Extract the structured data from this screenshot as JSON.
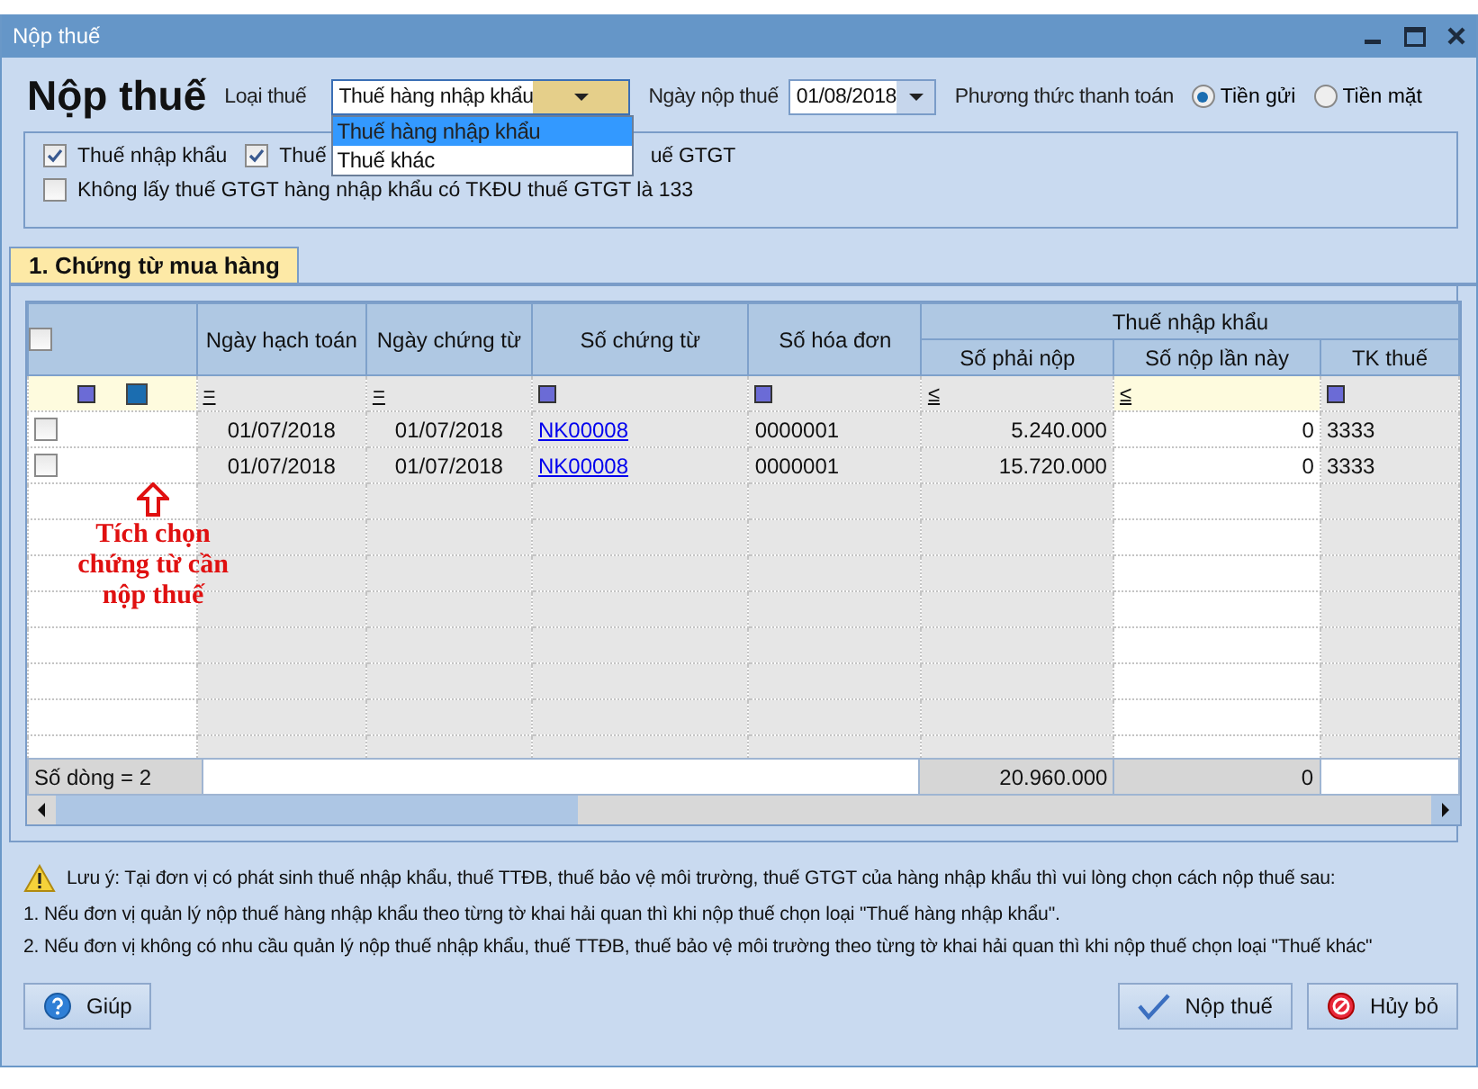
{
  "window": {
    "title": "Nộp thuế"
  },
  "header": {
    "title": "Nộp thuế",
    "tax_type": {
      "label": "Loại thuế",
      "value": "Thuế hàng nhập khẩu",
      "expanded": true,
      "options": [
        {
          "label": "Thuế hàng nhập khẩu",
          "selected": true
        },
        {
          "label": "Thuế khác",
          "selected": false
        }
      ]
    },
    "pay_date": {
      "label": "Ngày nộp thuế",
      "value": "01/08/2018"
    },
    "payment_method": {
      "label": "Phương thức thanh toán",
      "options": [
        {
          "label": "Tiền gửi",
          "selected": true
        },
        {
          "label": "Tiền mặt",
          "selected": false
        }
      ]
    }
  },
  "option_rows": [
    [
      {
        "label": "Thuế nhập khẩu",
        "checked": true
      },
      {
        "label": "Thuế",
        "checked": true,
        "visible_tail": "uế GTGT"
      }
    ],
    [
      {
        "label": "Không lấy thuế GTGT hàng nhập khẩu có TKĐU thuế GTGT là 133",
        "checked": false
      }
    ]
  ],
  "tabs": [
    {
      "label": "1. Chứng từ mua hàng",
      "selected": true
    }
  ],
  "grid": {
    "select_all_checked": false,
    "column_group": {
      "label": "Thuế nhập khẩu"
    },
    "columns": [
      {
        "label": "Ngày hạch toán",
        "kind": "date",
        "filter": {
          "kind": "operator",
          "text": "="
        }
      },
      {
        "label": "Ngày chứng từ",
        "kind": "date",
        "filter": {
          "kind": "operator",
          "text": "="
        }
      },
      {
        "label": "Số chứng từ",
        "kind": "link",
        "filter": {
          "kind": "box"
        }
      },
      {
        "label": "Số hóa đơn",
        "kind": "text",
        "filter": {
          "kind": "box"
        }
      },
      {
        "label": "Số phải nộp",
        "kind": "amount",
        "grouped": true,
        "filter": {
          "kind": "operator",
          "text": "≤"
        },
        "total": "20.960.000"
      },
      {
        "label": "Số nộp lần này",
        "kind": "amount",
        "grouped": true,
        "editable": true,
        "filter": {
          "kind": "operator",
          "text": "≤"
        },
        "total": "0"
      },
      {
        "label": "TK thuế",
        "kind": "text",
        "grouped": true,
        "filter": {
          "kind": "box"
        }
      }
    ],
    "rows": [
      {
        "checked": false,
        "cells": [
          "01/07/2018",
          "01/07/2018",
          "NK00008",
          "0000001",
          "5.240.000",
          "0",
          "3333"
        ]
      },
      {
        "checked": false,
        "cells": [
          "01/07/2018",
          "01/07/2018",
          "NK00008",
          "0000001",
          "15.720.000",
          "0",
          "3333"
        ]
      }
    ],
    "footer_label": "Số dòng = 2"
  },
  "annotation": {
    "text": "Tích chọn chứng từ cần nộp thuế"
  },
  "notes": {
    "warning": "Lưu ý: Tại đơn vị có phát sinh thuế nhập khẩu, thuế TTĐB, thuế bảo vệ môi trường, thuế GTGT của hàng nhập khẩu thì vui lòng chọn cách nộp thuế sau:",
    "lines": [
      "1. Nếu đơn vị quản lý nộp thuế hàng nhập khẩu theo từng tờ khai hải quan thì khi nộp thuế chọn loại \"Thuế hàng nhập khẩu\".",
      "2. Nếu đơn vị không có nhu cầu quản lý nộp thuế nhập khẩu, thuế TTĐB, thuế bảo vệ môi trường theo từng tờ khai hải quan thì khi nộp thuế chọn loại \"Thuế khác\""
    ]
  },
  "buttons": [
    {
      "kind": "help",
      "label": "Giúp"
    },
    {
      "kind": "submit",
      "label": "Nộp thuế"
    },
    {
      "kind": "cancel",
      "label": "Hủy bỏ"
    }
  ]
}
